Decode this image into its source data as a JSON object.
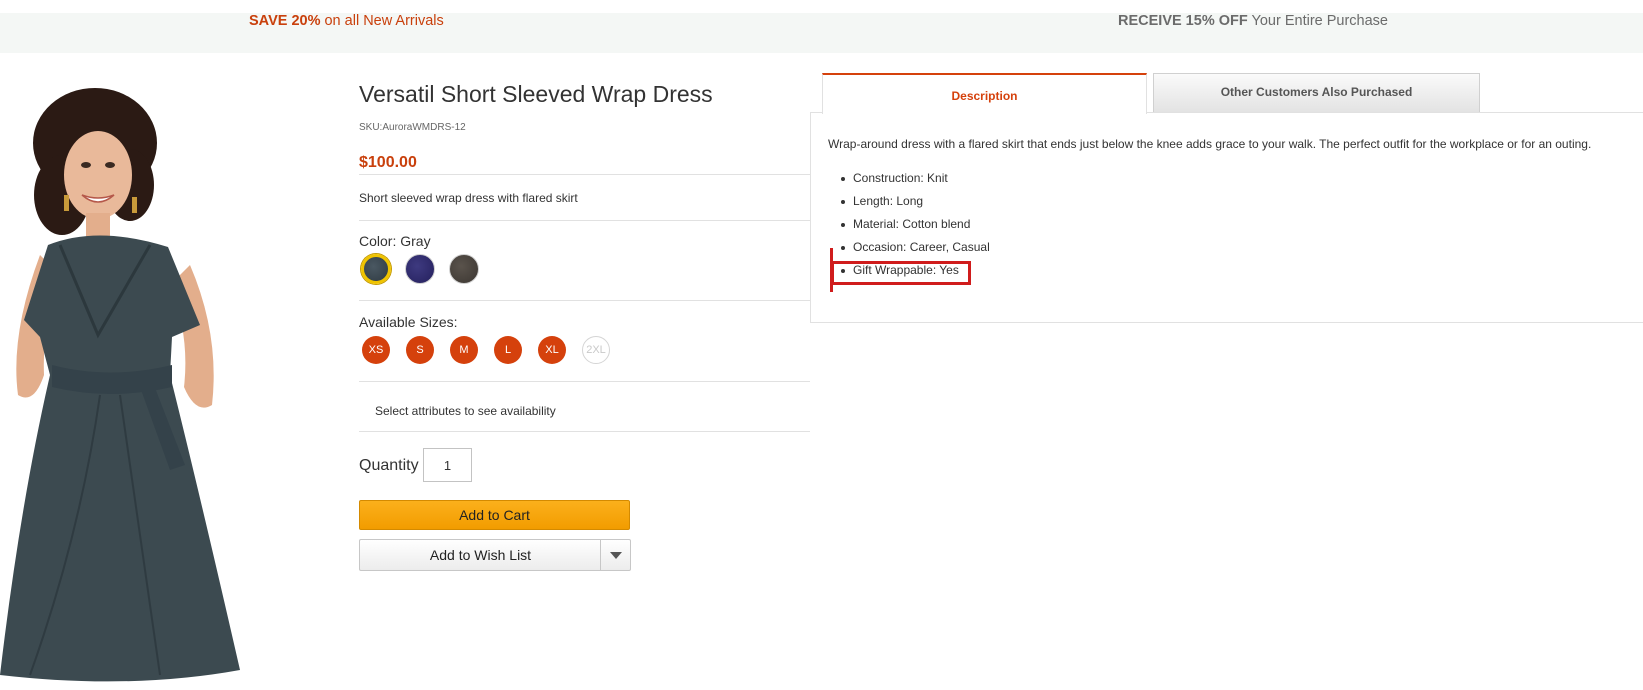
{
  "promo": {
    "left_bold": "SAVE 20%",
    "left_rest": " on all New Arrivals",
    "right_bold": "RECEIVE 15% OFF",
    "right_rest": " Your Entire Purchase"
  },
  "product": {
    "title": "Versatil Short Sleeved Wrap Dress",
    "sku": "SKU:AuroraWMDRS-12",
    "price": "$100.00",
    "short_description": "Short sleeved wrap dress with flared skirt",
    "color_label": "Color: Gray",
    "colors": [
      "Gray",
      "Navy",
      "Brown"
    ],
    "colors_hex": [
      "#3a4650",
      "#2f2a6e",
      "#4a443e"
    ],
    "sizes_label": "Available Sizes:",
    "sizes": [
      {
        "label": "XS",
        "available": true
      },
      {
        "label": "S",
        "available": true
      },
      {
        "label": "M",
        "available": true
      },
      {
        "label": "L",
        "available": true
      },
      {
        "label": "XL",
        "available": true
      },
      {
        "label": "2XL",
        "available": false
      }
    ],
    "availability_note": "Select attributes to see availability",
    "quantity_label": "Quantity",
    "quantity_value": "1",
    "add_to_cart": "Add to Cart",
    "add_to_wishlist": "Add to Wish List"
  },
  "tabs": [
    {
      "label": "Description",
      "active": true
    },
    {
      "label": "Other Customers Also Purchased",
      "active": false
    }
  ],
  "description": {
    "text": "Wrap-around dress with a flared skirt that ends just below the knee adds grace to your walk. The perfect outfit for the workplace or for an outing.",
    "attributes": [
      "Construction: Knit",
      "Length: Long",
      "Material: Cotton blend",
      "Occasion: Career, Casual",
      "Gift Wrappable: Yes"
    ]
  },
  "colors": {
    "accent": "#d5410c",
    "cart_button": "#f6a60c",
    "highlight": "#d01c1c"
  }
}
